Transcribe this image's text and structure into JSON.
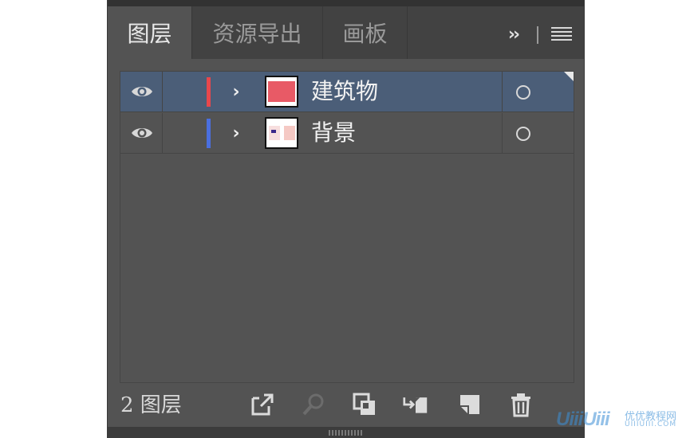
{
  "tabs": [
    {
      "label": "图层",
      "active": true
    },
    {
      "label": "资源导出",
      "active": false
    },
    {
      "label": "画板",
      "active": false
    }
  ],
  "tabbar": {
    "overflow_label": "››"
  },
  "layers": [
    {
      "name": "建筑物",
      "color": "#e8474c",
      "selected": true,
      "visible": true,
      "thumbnail": "solid-red"
    },
    {
      "name": "背景",
      "color": "#4a6fe0",
      "selected": false,
      "visible": true,
      "thumbnail": "light-pattern"
    }
  ],
  "footer": {
    "count_label": "2 图层",
    "buttons": [
      {
        "name": "export-icon",
        "enabled": true
      },
      {
        "name": "locate-object-icon",
        "enabled": false
      },
      {
        "name": "clipping-mask-icon",
        "enabled": true
      },
      {
        "name": "new-sublayer-icon",
        "enabled": true
      },
      {
        "name": "new-layer-icon",
        "enabled": true
      },
      {
        "name": "trash-icon",
        "enabled": true
      }
    ]
  },
  "watermark": {
    "logo": "UiiiUiii",
    "cn_text": "优优教程网",
    "en_text": "UIIIUIII.COM"
  },
  "colors": {
    "panel_bg": "#535353",
    "tabbar_bg": "#424242",
    "selected_row_bg": "#4b5e78"
  }
}
